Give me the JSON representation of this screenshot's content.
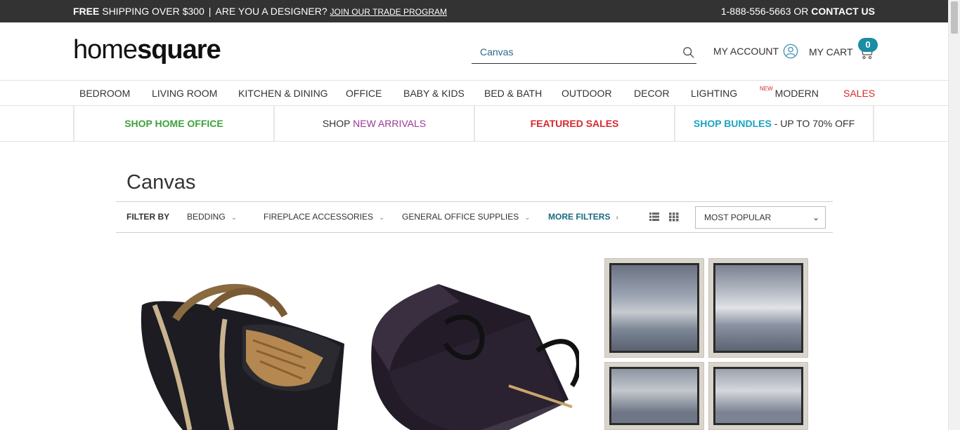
{
  "topbar": {
    "free": "FREE",
    "shipping": " SHIPPING OVER $300",
    "separator": "|",
    "designer": "ARE YOU A DESIGNER?",
    "trade_link": "JOIN OUR TRADE PROGRAM",
    "phone": "1-888-556-5663 OR ",
    "contact": "CONTACT US"
  },
  "header": {
    "logo_light": "home",
    "logo_bold": "square",
    "search_value": "Canvas",
    "account_label": "MY ACCOUNT",
    "cart_label": "MY CART",
    "cart_count": "0"
  },
  "nav": {
    "items": [
      "BEDROOM",
      "LIVING ROOM",
      "KITCHEN & DINING",
      "OFFICE",
      "BABY & KIDS",
      "BED & BATH",
      "OUTDOOR",
      "DECOR",
      "LIGHTING"
    ],
    "new_badge": "NEW",
    "modern": "MODERN",
    "sales": "SALES"
  },
  "promo": {
    "home_office": "SHOP HOME OFFICE",
    "shop": "SHOP ",
    "new_arrivals": "NEW ARRIVALS",
    "featured_sales": "FEATURED SALES",
    "bundles": "SHOP BUNDLES",
    "bundles_suffix": " - UP TO 70% OFF"
  },
  "page": {
    "title": "Canvas"
  },
  "filters": {
    "label": "FILTER BY",
    "bedding": "BEDDING",
    "fireplace": "FIREPLACE ACCESSORIES",
    "office_supplies": "GENERAL OFFICE SUPPLIES",
    "more": "MORE FILTERS",
    "sort_selected": "MOST POPULAR"
  },
  "colors": {
    "topbar_bg": "#333333",
    "accent_teal": "#1b8ca5",
    "sales_red": "#d7282f",
    "green": "#3ea13a",
    "purple": "#9b3a96"
  },
  "icons": {
    "search": "search-icon",
    "account": "user-circle-icon",
    "cart": "cart-icon",
    "list_view": "list-view-icon",
    "grid_view": "grid-view-icon"
  }
}
